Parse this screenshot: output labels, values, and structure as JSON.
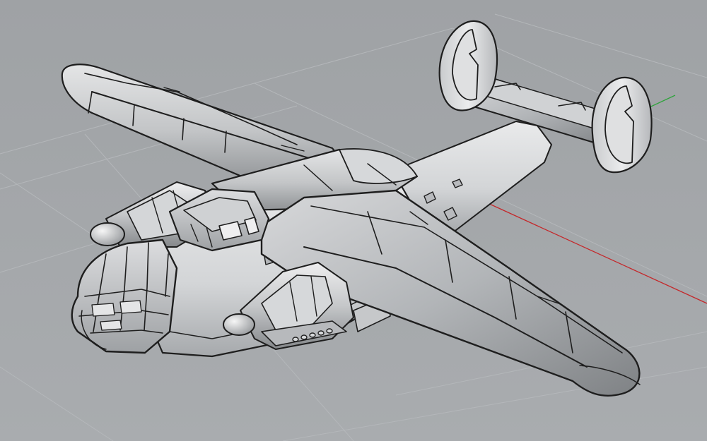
{
  "viewport": {
    "background_color": "#a5a8ab",
    "grid_color": "#b4b7ba",
    "x_axis_color": "#c4282b",
    "y_axis_color": "#2fa33c"
  },
  "model": {
    "kind": "seaplane-3d-model",
    "shade_light": "#e2e3e4",
    "shade_mid": "#bdbfc1",
    "shade_dark": "#8d9093",
    "outline_color": "#1e1e1e"
  }
}
